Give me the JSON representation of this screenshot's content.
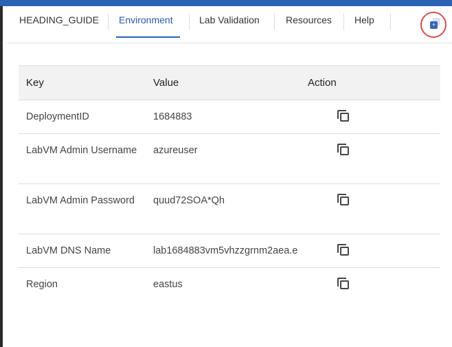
{
  "nav": {
    "tabs": [
      {
        "label": "HEADING_GUIDE"
      },
      {
        "label": "Environment",
        "active": true
      },
      {
        "label": "Lab Validation"
      },
      {
        "label": "Resources"
      },
      {
        "label": "Help"
      }
    ]
  },
  "accent": "#2a63b5",
  "fab": {
    "icon": "expand-panel-icon"
  },
  "table": {
    "headers": [
      "Key",
      "Value",
      "Action"
    ],
    "rows": [
      {
        "key": "DeploymentID",
        "value": "1684883",
        "action": "copy-icon"
      },
      {
        "key": "LabVM Admin Username",
        "value": "azureuser",
        "action": "copy-icon"
      },
      {
        "key": "LabVM Admin Password",
        "value": "quud72SOA*Qh",
        "action": "copy-icon"
      },
      {
        "key": "LabVM DNS Name",
        "value": "lab1684883vm5vhzzgrnm2aea.e",
        "action": "copy-icon"
      },
      {
        "key": "Region",
        "value": "eastus",
        "action": "copy-icon"
      }
    ]
  }
}
